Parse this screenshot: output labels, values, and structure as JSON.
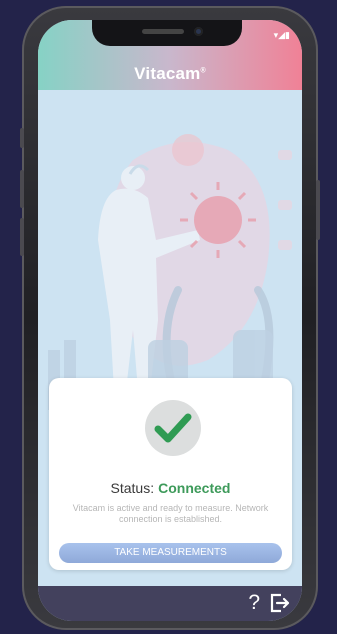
{
  "app": {
    "title": "Vitacam",
    "trademark": "®"
  },
  "status_bar": {
    "icons": "▾◢▮"
  },
  "card": {
    "status_label": "Status:",
    "status_value": "Connected",
    "description": "Vitacam is active and ready to measure. Network connection is established.",
    "button_label": "TAKE MEASUREMENTS"
  },
  "bottom_bar": {
    "help_label": "?"
  },
  "colors": {
    "header_start": "#86d2c5",
    "header_end": "#f08196",
    "status_connected": "#3d9a5a",
    "check_green": "#2f9b53",
    "button": "#9bb5e3",
    "bottom_bar": "#43415d"
  }
}
